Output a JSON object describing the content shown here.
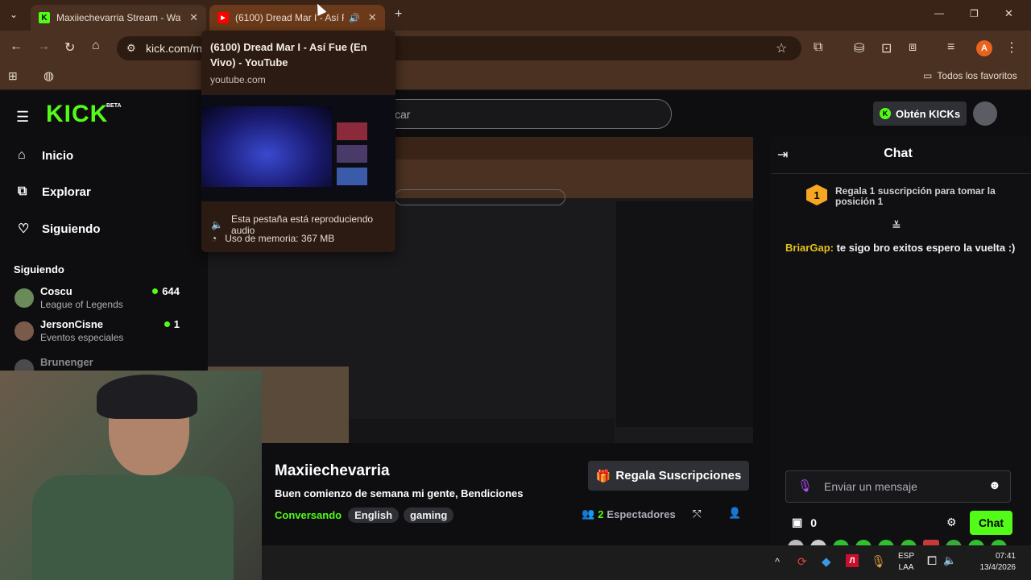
{
  "tabs": [
    {
      "title": "Maxiiechevarria Stream - Watch",
      "favicon": "K",
      "favicon_color": "#53fc18"
    },
    {
      "title": "(6100) Dread Mar I - Así Fue",
      "favicon": "youtube-icon",
      "favicon_color": "#ff0000"
    }
  ],
  "new_tab": "+",
  "window_controls": {
    "minimize": "—",
    "restore": "❐",
    "close": "✕"
  },
  "omnibox": {
    "url": "kick.com/ma"
  },
  "bookmarks": {
    "right_label": "Todos los favoritos"
  },
  "profile_initial": "A",
  "tooltip": {
    "title": "(6100) Dread Mar I - Así Fue (En Vivo) - YouTube",
    "domain": "youtube.com",
    "audio": "Esta pestaña está reproduciendo audio",
    "memory": "Uso de memoria: 367 MB"
  },
  "kick": {
    "logo": "KICK",
    "beta": "BETA",
    "search_placeholder": "scar",
    "get_kicks": "Obtén KICKs",
    "nav": [
      {
        "label": "Inicio",
        "icon": "home-icon"
      },
      {
        "label": "Explorar",
        "icon": "explore-icon"
      },
      {
        "label": "Siguiendo",
        "icon": "heart-icon"
      }
    ],
    "following_title": "Siguiendo",
    "channels": [
      {
        "name": "Coscu",
        "category": "League of Legends",
        "viewers": "644"
      },
      {
        "name": "JersonCisne",
        "category": "Eventos especiales",
        "viewers": "1"
      },
      {
        "name": "Brunenger",
        "category": "",
        "viewers": ""
      }
    ],
    "stream": {
      "channel": "Maxiiechevarria",
      "title": "Buen comienzo de semana mi gente, Bendiciones",
      "category": "Conversando",
      "tags": [
        "English",
        "gaming"
      ],
      "viewers_count": "2",
      "viewers_label": "Espectadores",
      "gift_button": "Regala Suscripciones"
    },
    "chat": {
      "header": "Chat",
      "pinned": "Regala 1 suscripción para tomar la posición 1",
      "rank": "1",
      "messages": [
        {
          "user": "BriarGap",
          "text": "te sigo bro exitos espero la vuelta :)",
          "color": "#e3c01d"
        }
      ],
      "input_placeholder": "Enviar un mensaje",
      "kicks": "0",
      "send": "Chat"
    }
  },
  "taskbar": {
    "lang1": "ESP",
    "lang2": "LAA",
    "time": "07:41",
    "date": "13/4/2026"
  },
  "colors": {
    "accent": "#53fc18",
    "browser": "#4a3122"
  }
}
